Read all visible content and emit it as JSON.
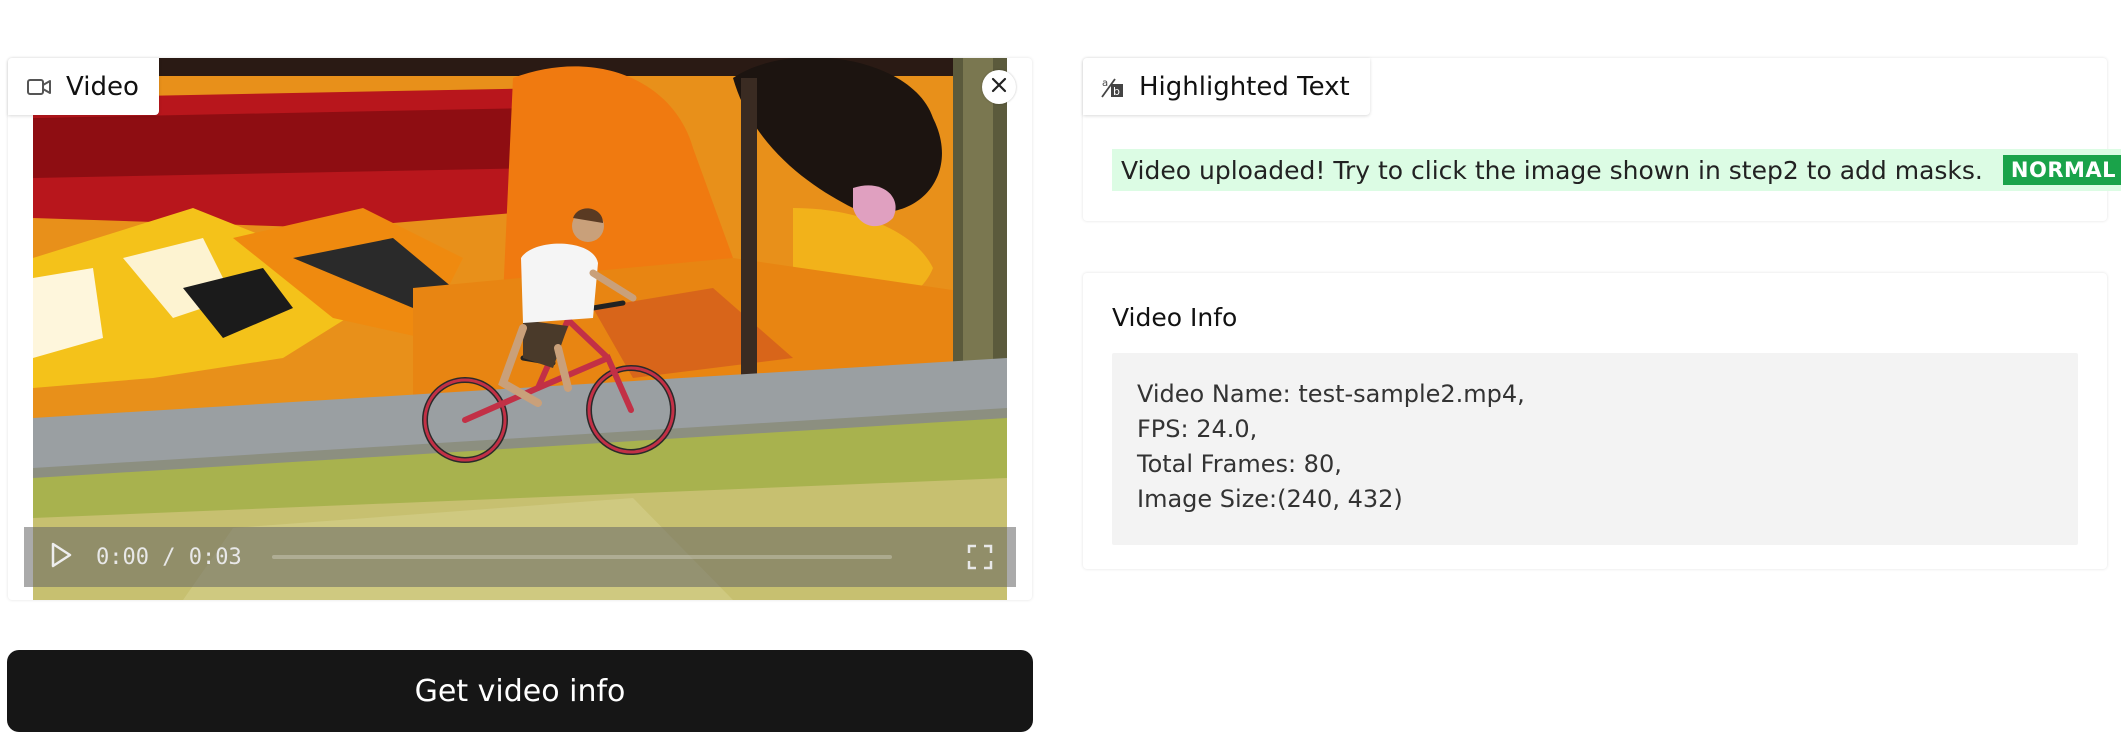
{
  "video_panel": {
    "label": "Video",
    "label_icon": "video-camera-icon",
    "close_icon": "close-icon",
    "player": {
      "time_display": "0:00 / 0:03",
      "progress": 0.0,
      "play_icon": "play-icon",
      "fullscreen_icon": "fullscreen-icon"
    }
  },
  "get_info_button": {
    "label": "Get video info"
  },
  "highlighted_text_panel": {
    "label": "Highlighted Text",
    "label_icon": "highlight-text-icon",
    "message": "Video uploaded! Try to click the image shown in step2 to add masks.",
    "tag": "NORMAL",
    "highlight_color": "#dcfce4",
    "tag_color": "#1aa34a"
  },
  "video_info_panel": {
    "title": "Video Info",
    "lines": [
      "Video Name: test-sample2.mp4,",
      "FPS: 24.0,",
      "Total Frames: 80,",
      "Image Size:(240, 432)"
    ]
  }
}
